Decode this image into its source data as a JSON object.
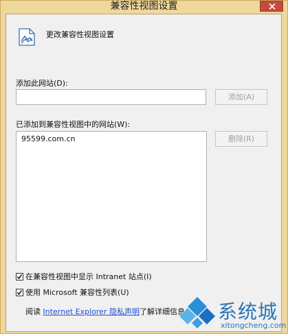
{
  "window": {
    "title": "兼容性视图设置"
  },
  "header": {
    "text": "更改兼容性视图设置"
  },
  "add_site": {
    "label": "添加此网站(D):",
    "value": "",
    "placeholder": "",
    "add_button": "添加(A)"
  },
  "sites_list": {
    "label": "已添加到兼容性视图中的网站(W):",
    "items": [
      "95599.com.cn"
    ],
    "remove_button": "删除(R)"
  },
  "options": {
    "intranet_label": "在兼容性视图中显示 Intranet 站点(I)",
    "intranet_checked": true,
    "microsoft_list_label": "使用 Microsoft 兼容性列表(U)",
    "microsoft_list_checked": true
  },
  "info": {
    "prefix": "阅读 ",
    "link": "Internet Explorer 隐私声明",
    "suffix": "了解详细信息"
  },
  "watermark": {
    "brand_cn": "系统城",
    "brand_en": "xitongcheng.com"
  },
  "colors": {
    "title_bar": "#f0d79a",
    "close_button": "#c64a3b",
    "link": "#1a4fd8",
    "watermark": "#2a73b8"
  }
}
